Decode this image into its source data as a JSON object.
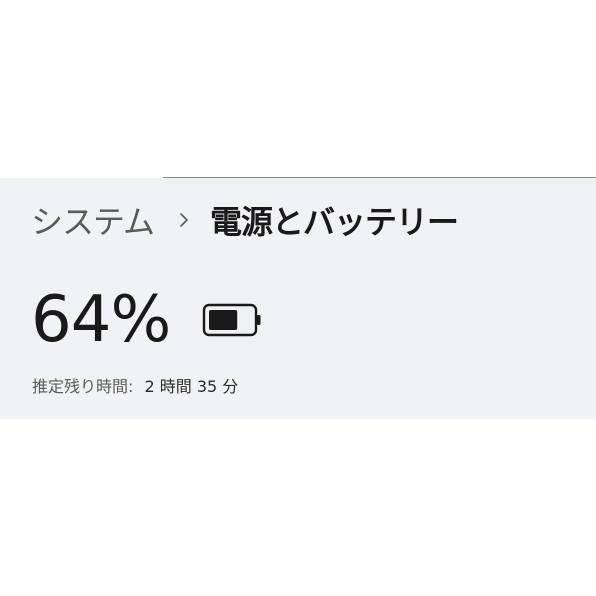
{
  "breadcrumb": {
    "parent": "システム",
    "separator_icon": "chevron-right-icon",
    "current": "電源とバッテリー"
  },
  "battery": {
    "percent_label": "64%",
    "level_fraction": 0.64,
    "icon": "battery-icon",
    "remaining_label": "推定残り時間:",
    "remaining_value": "2 時間 35 分"
  },
  "colors": {
    "panel_background": "#f1f2f6",
    "text_primary": "#1a1a1a",
    "text_secondary": "#5a5a5a"
  }
}
